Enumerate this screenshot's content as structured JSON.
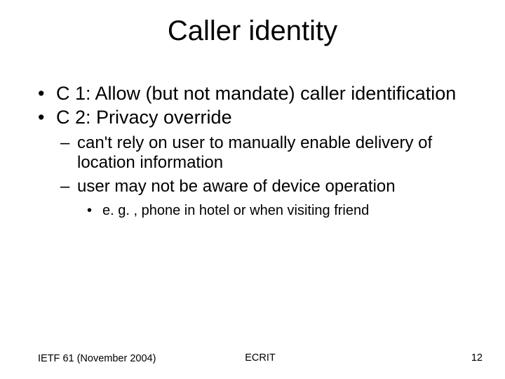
{
  "title": "Caller identity",
  "bullets": {
    "c1": "C 1: Allow (but not mandate) caller identification",
    "c2": "C 2: Privacy override",
    "sub1": "can't rely on user to manually enable delivery of location information",
    "sub2": "user may not be aware of device operation",
    "subsub1": "e. g. , phone in hotel or when visiting friend"
  },
  "footer": {
    "left": "IETF 61 (November 2004)",
    "center": "ECRIT",
    "page": "12"
  }
}
